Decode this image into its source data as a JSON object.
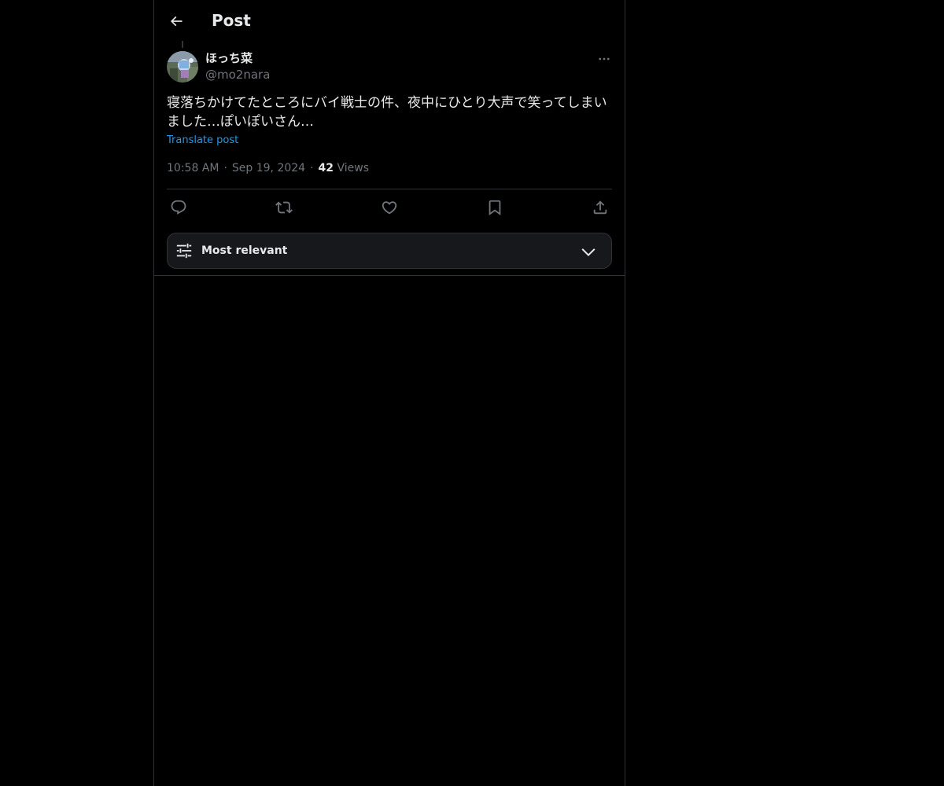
{
  "header": {
    "title": "Post",
    "back_icon": "arrow-left-icon"
  },
  "post": {
    "author": {
      "display_name": "ほっち菜",
      "handle": "@mo2nara"
    },
    "text": "寝落ちかけてたところにバイ戦士の件、夜中にひとり大声で笑ってしまいました…ぽいぽいさん…",
    "translate_label": "Translate post",
    "time": "10:58 AM",
    "separator": "·",
    "date": "Sep 19, 2024",
    "views_count": "42",
    "views_label": "Views"
  },
  "actions": [
    {
      "name": "reply-icon"
    },
    {
      "name": "repost-icon"
    },
    {
      "name": "like-icon"
    },
    {
      "name": "bookmark-icon"
    },
    {
      "name": "share-icon"
    }
  ],
  "sort": {
    "label": "Most relevant",
    "icon": "sliders-icon",
    "chevron": "chevron-down-icon"
  },
  "colors": {
    "background": "#000000",
    "text": "#e7e9ea",
    "secondary_text": "#71767b",
    "accent": "#1d9bf0",
    "border": "#2f3336"
  }
}
